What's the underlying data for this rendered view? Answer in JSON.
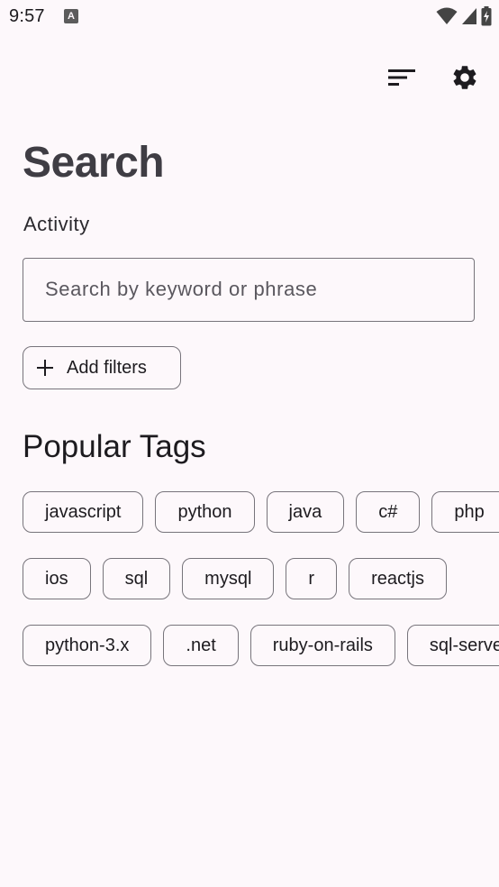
{
  "status_bar": {
    "time": "9:57",
    "notification_icon": "A"
  },
  "icons": {
    "sort": "sort-icon",
    "settings": "gear-icon",
    "add": "plus-icon",
    "wifi": "wifi-icon",
    "signal": "signal-icon",
    "battery": "battery-icon"
  },
  "header": {
    "title": "Search",
    "scope_label": "Activity"
  },
  "search": {
    "placeholder": "Search by keyword or phrase",
    "value": ""
  },
  "filters": {
    "add_label": "Add filters"
  },
  "popular_tags": {
    "title": "Popular Tags",
    "rows": [
      [
        "javascript",
        "python",
        "java",
        "c#",
        "php"
      ],
      [
        "ios",
        "sql",
        "mysql",
        "r",
        "reactjs"
      ],
      [
        "python-3.x",
        ".net",
        "ruby-on-rails",
        "sql-server"
      ]
    ]
  },
  "colors": {
    "background": "#fdf8fb",
    "outline": "#77747b",
    "title": "#3f3d44",
    "text": "#1d1b1f"
  }
}
